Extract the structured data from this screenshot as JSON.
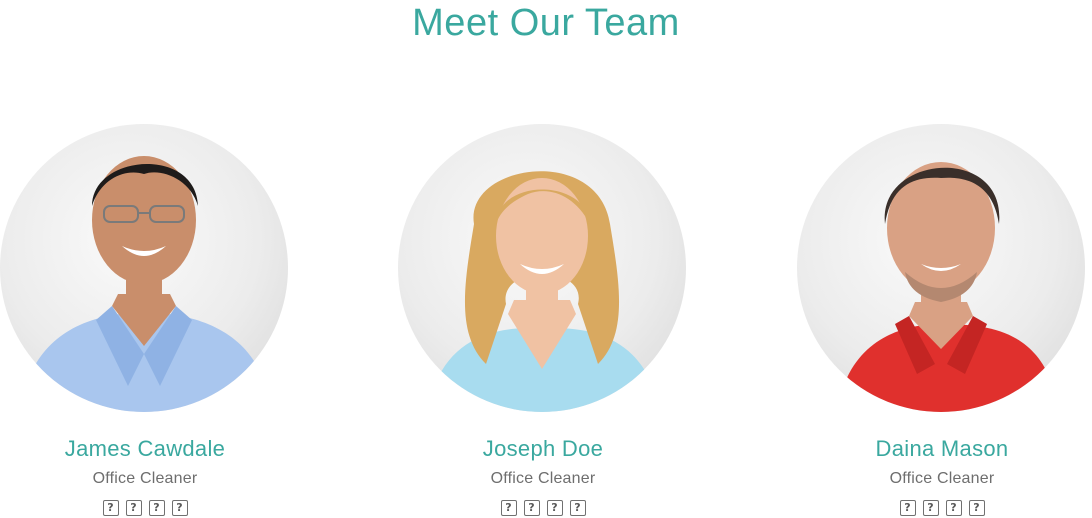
{
  "section": {
    "title": "Meet Our Team"
  },
  "members": [
    {
      "name": "James Cawdale",
      "role": "Office Cleaner",
      "socials": [
        "?",
        "?",
        "?",
        "?"
      ],
      "shirt_color": "#a9c6ee",
      "hair_color": "#1e1b1a",
      "skin_color": "#c98e6b"
    },
    {
      "name": "Joseph Doe",
      "role": "Office Cleaner",
      "socials": [
        "?",
        "?",
        "?",
        "?"
      ],
      "shirt_color": "#a8dcef",
      "hair_color": "#d9a960",
      "skin_color": "#f0c2a3"
    },
    {
      "name": "Daina Mason",
      "role": "Office Cleaner",
      "socials": [
        "?",
        "?",
        "?",
        "?"
      ],
      "shirt_color": "#e0302d",
      "hair_color": "#3a2f2a",
      "skin_color": "#d9a184"
    }
  ],
  "colors": {
    "accent": "#3aa89f",
    "role_text": "#6e6e6e"
  }
}
